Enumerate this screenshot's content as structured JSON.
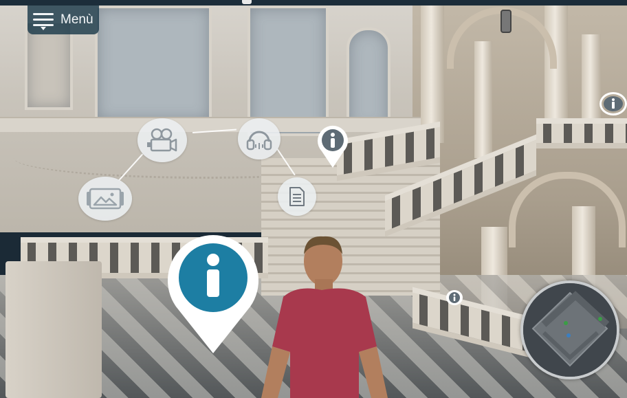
{
  "menu": {
    "label": "Menù",
    "icon": "hamburger-menu-icon"
  },
  "radial_menu": {
    "items": [
      {
        "name": "image-gallery",
        "icon": "image-icon"
      },
      {
        "name": "video",
        "icon": "video-camera-icon"
      },
      {
        "name": "audio-guide",
        "icon": "headphones-icon"
      },
      {
        "name": "document",
        "icon": "document-icon"
      }
    ]
  },
  "points_of_interest": {
    "large_pin": {
      "icon": "info-icon",
      "color": "#1d7ea3"
    },
    "small_pin": {
      "icon": "info-icon",
      "color": "#5e6b75"
    },
    "far_badge_right": {
      "icon": "info-icon"
    },
    "far_badge_stairs": {
      "icon": "info-icon"
    }
  },
  "minimap": {
    "icon": "minimap"
  },
  "colors": {
    "menu_bg": "#1c3a4a",
    "accent": "#1d7ea3",
    "avatar_shirt": "#a8394d"
  }
}
